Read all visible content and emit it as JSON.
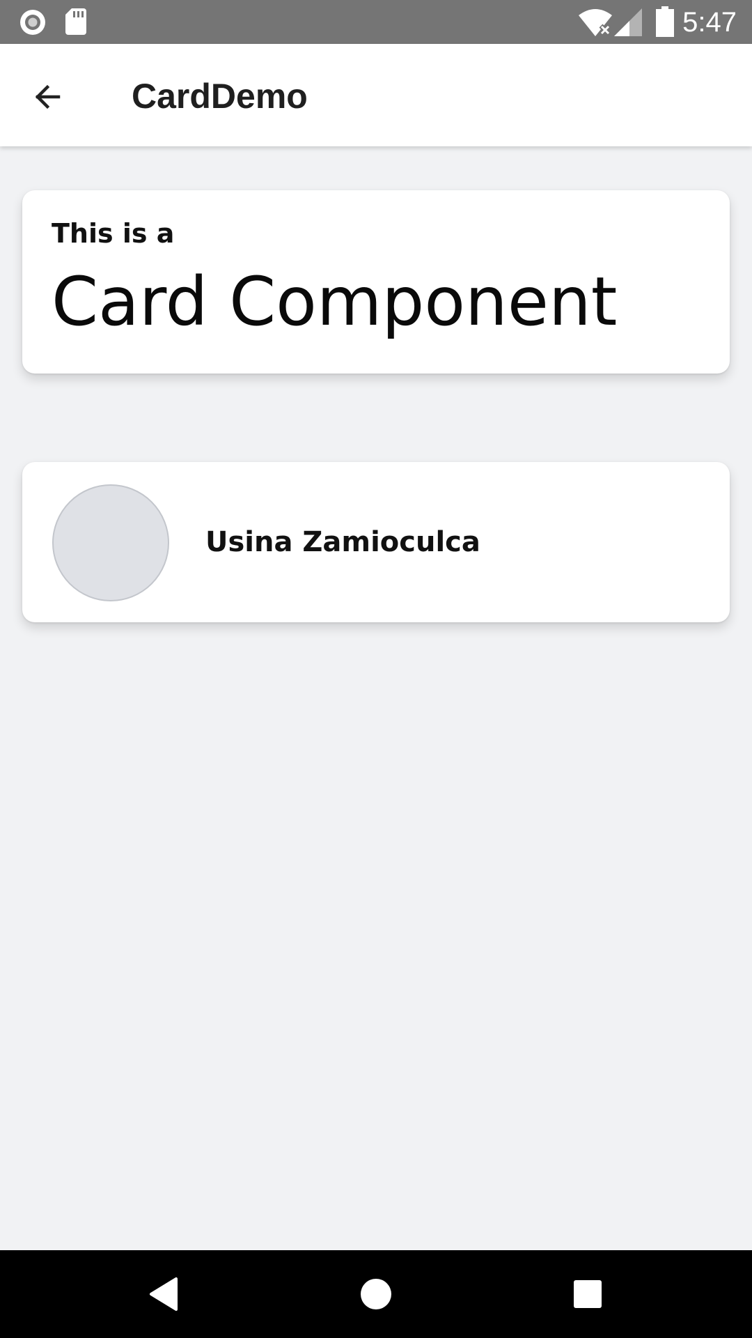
{
  "status_bar": {
    "time": "5:47",
    "left_icons": [
      "record-icon",
      "sd-card-icon"
    ],
    "right_icons": [
      "wifi-no-internet-icon",
      "cell-signal-icon",
      "battery-icon"
    ]
  },
  "app_bar": {
    "title": "CardDemo",
    "back_icon": "arrow-back-icon"
  },
  "cards": {
    "intro": {
      "subtitle": "This is a",
      "title": "Card Component"
    },
    "profile": {
      "name": "Usina Zamioculca",
      "avatar_icon": "avatar-placeholder"
    }
  },
  "nav_bar": {
    "buttons": [
      "back-triangle-icon",
      "home-circle-icon",
      "recents-square-icon"
    ]
  },
  "colors": {
    "status_bar": "#757575",
    "app_bar": "#ffffff",
    "background": "#f1f2f4",
    "card": "#ffffff",
    "avatar": "#dfe1e6",
    "nav_bar": "#000000"
  }
}
